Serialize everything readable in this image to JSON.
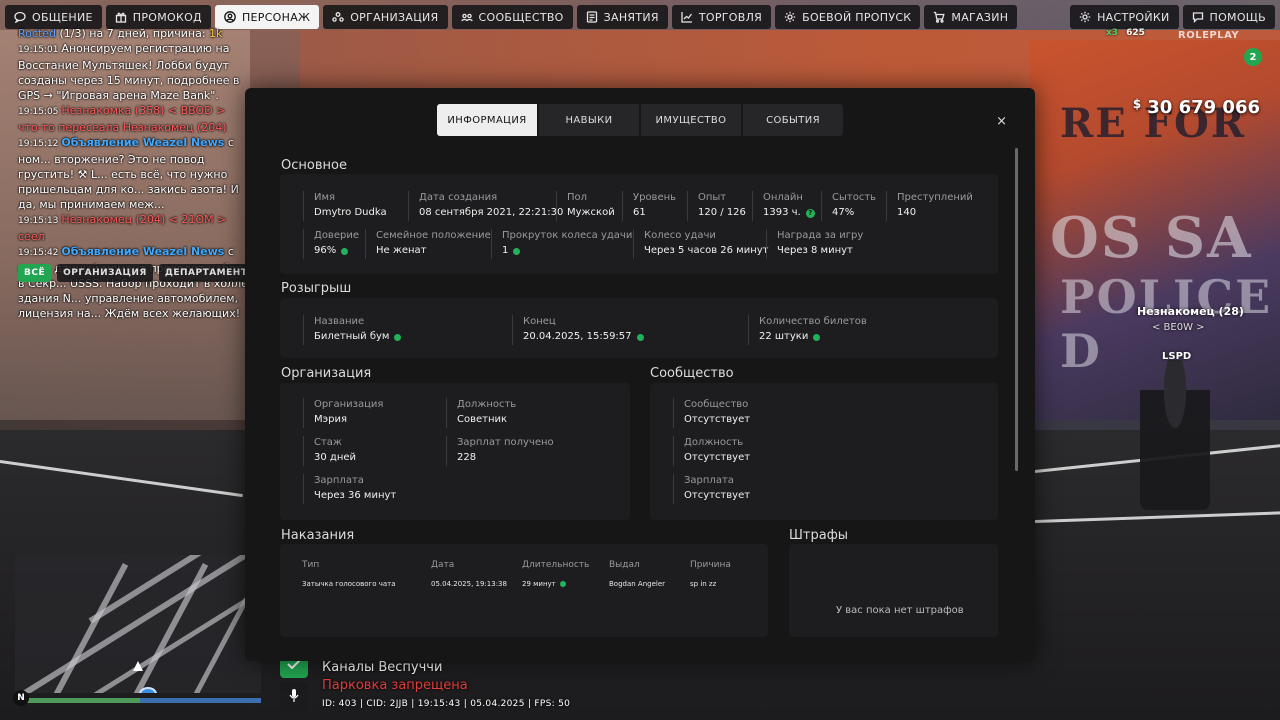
{
  "nav": {
    "left": [
      {
        "label": "ОБЩЕНИЕ",
        "icon": "chat-icon"
      },
      {
        "label": "ПРОМОКОД",
        "icon": "gift-icon"
      },
      {
        "label": "ПЕРСОНАЖ",
        "icon": "user-icon",
        "active": true
      },
      {
        "label": "ОРГАНИЗАЦИЯ",
        "icon": "organization-icon"
      },
      {
        "label": "СООБЩЕСТВО",
        "icon": "community-icon"
      },
      {
        "label": "ЗАНЯТИЯ",
        "icon": "tasks-icon"
      },
      {
        "label": "ТОРГОВЛЯ",
        "icon": "chart-icon"
      },
      {
        "label": "БОЕВОЙ ПРОПУСК",
        "icon": "gear-icon"
      },
      {
        "label": "МАГАЗИН",
        "icon": "cart-icon"
      }
    ],
    "right": [
      {
        "label": "НАСТРОЙКИ",
        "icon": "settings-icon"
      },
      {
        "label": "ПОМОЩЬ",
        "icon": "help-icon"
      }
    ]
  },
  "chat": {
    "lines": [
      {
        "time": "",
        "parts": [
          {
            "t": "Rocted",
            "c": "mag"
          },
          {
            "t": " (1/3) на 7 дней, причина: ",
            "c": ""
          },
          {
            "t": "1k",
            "c": "gold"
          }
        ]
      },
      {
        "time": "19:15:01",
        "parts": [
          {
            "t": "Анонсируем регистрацию на Восстание Мультяшек! Лобби будут созданы через 15 минут, подробнее в GPS → \"Игровая арена Maze Bank\".",
            "c": ""
          }
        ]
      },
      {
        "time": "19:15:05",
        "parts": [
          {
            "t": "Незнакомка (358) < BBOD > что-то пересеала Незнакомец (204)",
            "c": "red"
          }
        ]
      },
      {
        "time": "19:15:12",
        "parts": [
          {
            "t": "Объявление Weazel News",
            "c": "blue"
          },
          {
            "t": " с ном... вторжение? Это не повод грустить! ⚒ L... есть всё, что нужно пришельцам для ко... закись азота! И да, мы принимаем меж...",
            "c": ""
          }
        ]
      },
      {
        "time": "19:15:13",
        "parts": [
          {
            "t": "Незнакомец (204) < 21OM > сеел",
            "c": "red"
          }
        ]
      },
      {
        "time": "19:15:42",
        "parts": [
          {
            "t": "Объявление Weazel News",
            "c": "blue"
          },
          {
            "t": " с ном... данный момент проходит набор в Секр... USSS. Набор проходит в холле здания N... управление автомобилем, лицензия на... Ждём всех желающих!",
            "c": ""
          }
        ]
      }
    ],
    "tabs": [
      {
        "label": "ВСЁ",
        "active": true
      },
      {
        "label": "ОРГАНИЗАЦИЯ"
      },
      {
        "label": "ДЕПАРТАМЕНТ"
      }
    ]
  },
  "hud": {
    "currency": "$",
    "money": "30 679 066",
    "multiplier": "x3",
    "points": "625",
    "logo": "ROLEPLAY",
    "badge": "2",
    "npc_name": "Незнакомец (28)",
    "npc_tag": "< BE0W >",
    "npc_org": "LSPD"
  },
  "bottom": {
    "place": "Каналы Веспуччи",
    "warning": "Парковка запрещена",
    "id_line": "ID: 403 | CID: 2JJB | 19:15:43 | 05.04.2025 | FPS: 50",
    "compass": "N"
  },
  "modal": {
    "tabs": [
      {
        "label": "ИНФОРМАЦИЯ",
        "active": true
      },
      {
        "label": "НАВЫКИ"
      },
      {
        "label": "ИМУЩЕСТВО"
      },
      {
        "label": "СОБЫТИЯ"
      }
    ],
    "close": "×",
    "basic": {
      "title": "Основное",
      "row1": [
        {
          "label": "Имя",
          "value": "Dmytro Dudka"
        },
        {
          "label": "Дата создания",
          "value": "08 сентября 2021, 22:21:30"
        },
        {
          "label": "Пол",
          "value": "Мужской"
        },
        {
          "label": "Уровень",
          "value": "61"
        },
        {
          "label": "Опыт",
          "value": "120 / 126"
        },
        {
          "label": "Онлайн",
          "value": "1393 ч.",
          "help": "?"
        },
        {
          "label": "Сытость",
          "value": "47%"
        },
        {
          "label": "Преступлений",
          "value": "140"
        }
      ],
      "row2": [
        {
          "label": "Доверие",
          "value": "96%",
          "dot": true
        },
        {
          "label": "Семейное положение",
          "value": "Не женат"
        },
        {
          "label": "Прокруток колеса удачи",
          "value": "1",
          "dot": true
        },
        {
          "label": "Колесо удачи",
          "value": "Через 5 часов 26 минут"
        },
        {
          "label": "Награда за игру",
          "value": "Через 8 минут"
        }
      ]
    },
    "raffle": {
      "title": "Розыгрыш",
      "fields": [
        {
          "label": "Название",
          "value": "Билетный бум",
          "dot": true
        },
        {
          "label": "Конец",
          "value": "20.04.2025, 15:59:57",
          "dot": true
        },
        {
          "label": "Количество билетов",
          "value": "22 штуки",
          "dot": true
        }
      ]
    },
    "organization": {
      "title": "Организация",
      "fields": [
        {
          "label": "Организация",
          "value": "Мэрия"
        },
        {
          "label": "Должность",
          "value": "Советник"
        },
        {
          "label": "Стаж",
          "value": "30 дней"
        },
        {
          "label": "Зарплат получено",
          "value": "228"
        },
        {
          "label": "Зарплата",
          "value": "Через 36 минут"
        }
      ]
    },
    "community": {
      "title": "Сообщество",
      "fields": [
        {
          "label": "Сообщество",
          "value": "Отсутствует"
        },
        {
          "label": "Должность",
          "value": "Отсутствует"
        },
        {
          "label": "Зарплата",
          "value": "Отсутствует"
        }
      ]
    },
    "punishments": {
      "title": "Наказания",
      "headers": [
        "Тип",
        "Дата",
        "Длительность",
        "Выдал",
        "Причина"
      ],
      "rows": [
        [
          "Затычка голосового чата",
          "05.04.2025, 19:13:38",
          "29 минут",
          "Bogdan Angeler",
          "sp in zz"
        ]
      ]
    },
    "fines": {
      "title": "Штрафы",
      "empty": "У вас пока нет штрафов"
    }
  }
}
